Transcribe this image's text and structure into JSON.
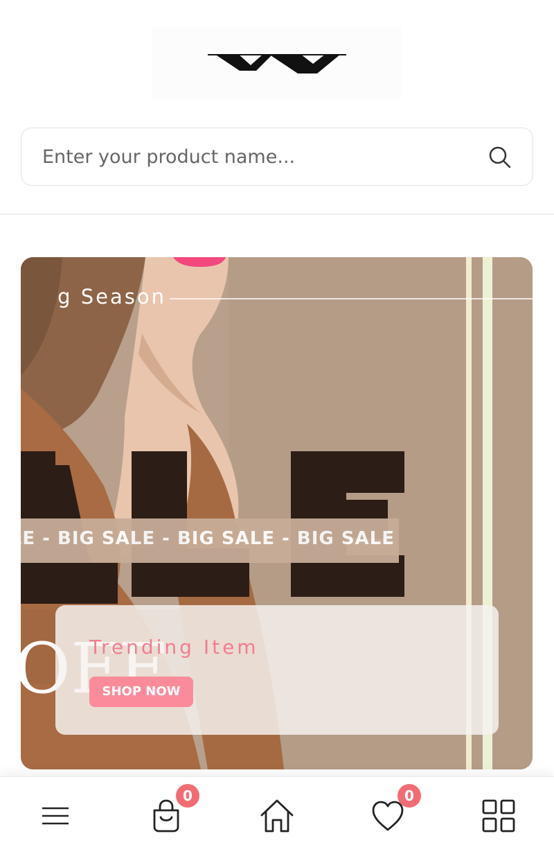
{
  "header": {
    "logo_alt": "YV"
  },
  "search": {
    "placeholder": "Enter your product name..."
  },
  "banner": {
    "season_text": "g Season",
    "big_sale_text": "SALE - BIG SALE - BIG SALE - BIG SALE",
    "sale_graphic_text": "ALE",
    "off_graphic_text": "OFF",
    "card_title": "Trending Item",
    "shop_button": "SHOP NOW"
  },
  "bottom_nav": {
    "cart_count": "0",
    "wishlist_count": "0"
  },
  "colors": {
    "accent": "#fb8b9a",
    "badge": "#f26d73"
  },
  "icons": [
    "search-icon",
    "menu-icon",
    "shopping-bag-icon",
    "home-icon",
    "heart-icon",
    "grid-icon"
  ]
}
